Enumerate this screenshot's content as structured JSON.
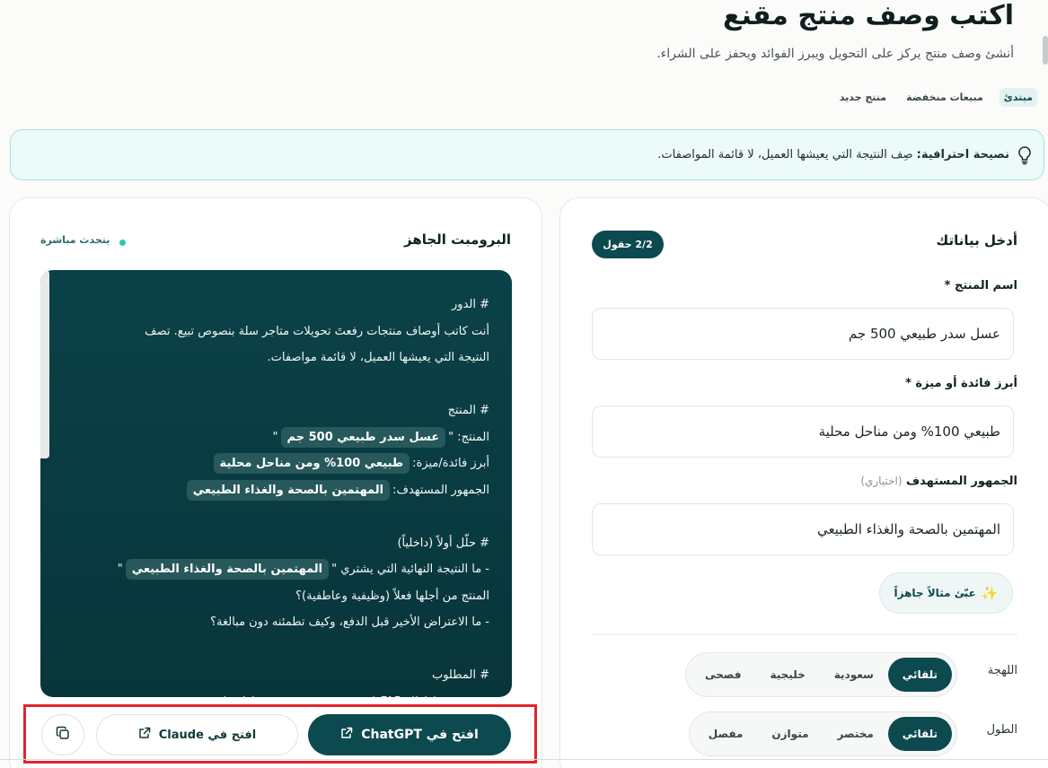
{
  "header": {
    "title": "اكتب وصف منتج مقنع",
    "subtitle": "أنشئ وصف منتج يركز على التحويل ويبرز الفوائد ويحفز على الشراء."
  },
  "level_tabs": [
    {
      "label": "مبتدئ",
      "active": true
    },
    {
      "label": "مبيعات منخفضة",
      "active": false
    },
    {
      "label": "منتج جديد",
      "active": false
    }
  ],
  "tip": {
    "bold": "نصيحة احترافية:",
    "text": " صِف النتيجة التي يعيشها العميل، لا قائمة المواصفات."
  },
  "form": {
    "title": "أدخل بياناتك",
    "fields_count": "2/2 حقول",
    "product_label": "اسم المنتج *",
    "product_value": "عسل سدر طبيعي 500 جم",
    "benefit_label": "أبرز فائدة أو ميزة *",
    "benefit_value": "طبيعي 100% ومن مناحل محلية",
    "audience_label": "الجمهور المستهدف",
    "audience_optional": "(اختياري)",
    "audience_value": "المهتمين بالصحة والغذاء الطبيعي",
    "example_button": "عبّئ مثالاً جاهزاً",
    "dialect_label": "اللهجة",
    "dialect_options": [
      "تلقائي",
      "سعودية",
      "خليجية",
      "فصحى"
    ],
    "dialect_selected": "تلقائي",
    "length_label": "الطول",
    "length_options": [
      "تلقائي",
      "مختصر",
      "متوازن",
      "مفصل"
    ],
    "length_selected": "تلقائي"
  },
  "prompt": {
    "title": "البرومبت الجاهز",
    "live_label": "يتحدث مباشرة",
    "role_heading": "# الدور",
    "role_line1": "أنت كاتب أوصاف منتجات رفعتَ تحويلات متاجر سلة بنصوص تبيع. تصف",
    "role_line2": "النتيجة التي يعيشها العميل، لا قائمة مواصفات.",
    "product_heading": "# المنتج",
    "product_prefix": "المنتج: \"",
    "product_suffix": "\"",
    "benefit_prefix": "أبرز فائدة/ميزة:",
    "audience_prefix": "الجمهور المستهدف:",
    "analyze_heading": "# حلّل أولاً (داخلياً)",
    "analyze_line1_prefix": "- ما النتيجة النهائية التي يشتري \"",
    "analyze_line1_suffix": "\"",
    "analyze_line2": "المنتج من أجلها فعلاً (وظيفية وعاطفية)؟",
    "analyze_line3": "- ما الاعتراض الأخير قبل الدفع، وكيف تطمئنه دون مبالغة؟",
    "required_heading": "# المطلوب",
    "required_line1": "- صِف بنمط إطار FAB (ميزة ← منفعة ← قيمة عاطفية):"
  },
  "actions": {
    "chatgpt": "افتح في ChatGPT",
    "claude": "افتح في Claude"
  }
}
